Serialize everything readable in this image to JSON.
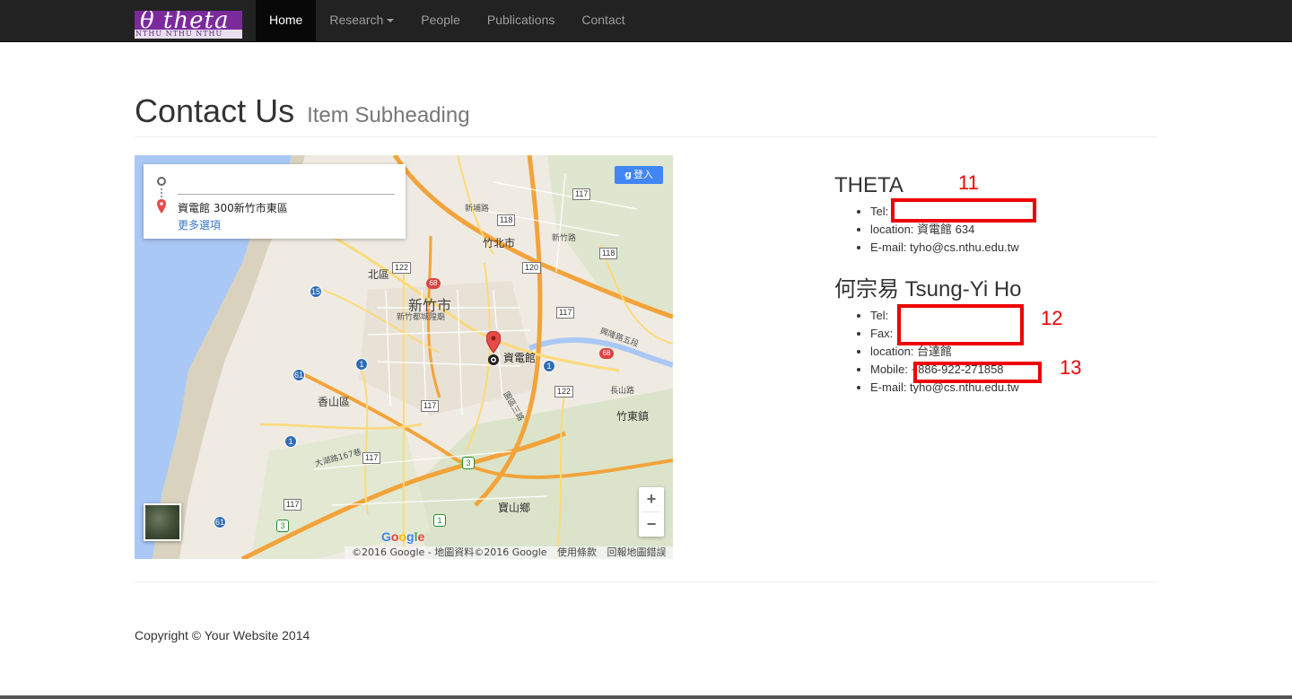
{
  "navbar": {
    "brand_title": "θ theta",
    "brand_subtitle": "NTHU NTHU NTHU",
    "items": [
      {
        "label": "Home"
      },
      {
        "label": "Research"
      },
      {
        "label": "People"
      },
      {
        "label": "Publications"
      },
      {
        "label": "Contact"
      }
    ]
  },
  "header": {
    "title": "Contact Us",
    "subheading": "Item Subheading"
  },
  "map": {
    "destination": "資電館 300新竹市東區",
    "more_options": "更多選項",
    "login_label": "登入",
    "marker_label": "資電館",
    "zoom_in": "+",
    "zoom_out": "−",
    "google_logo": "Google",
    "attribution": [
      "©2016 Google - 地圖資料©2016 Google",
      "使用條款",
      "回報地圖錯誤"
    ],
    "labels": {
      "city": "新竹市",
      "temple": "新竹都城隍廟",
      "north": "北區",
      "zhubei": "竹北市",
      "xiangshan": "香山區",
      "zhudong": "竹東鎮",
      "baoshan": "寶山鄉",
      "road1": "興隆路五段",
      "road2": "大湖路167巷",
      "road3": "園區三路",
      "road4": "長山路",
      "road5": "新竹路",
      "road6": "新埔路"
    },
    "shields": [
      "117",
      "118",
      "120",
      "118",
      "122",
      "117",
      "122",
      "117",
      "117",
      "117",
      "15",
      "61",
      "1",
      "1",
      "1",
      "61",
      "3",
      "3",
      "1",
      "68",
      "68"
    ]
  },
  "contacts": {
    "theta": {
      "name": "THETA",
      "tel": "Tel:",
      "location": "location: 資電館 634",
      "email": "E-mail: tyho@cs.nthu.edu.tw"
    },
    "person": {
      "name": "何宗易 Tsung-Yi Ho",
      "tel": "Tel:",
      "fax": "Fax:",
      "location": "location: 台達館",
      "mobile": "Mobile: +886-922-271858",
      "email": "E-mail: tyho@cs.nthu.edu.tw"
    }
  },
  "annotations": {
    "a11": "11",
    "a12": "12",
    "a13": "13"
  },
  "footer": {
    "copyright": "Copyright © Your Website 2014"
  },
  "colors": {
    "navbar_bg": "#222222",
    "brand_bg": "#7b2a9c",
    "annotation_red": "#e00000",
    "water": "#a9c8f5",
    "highway": "#f2a33a"
  }
}
